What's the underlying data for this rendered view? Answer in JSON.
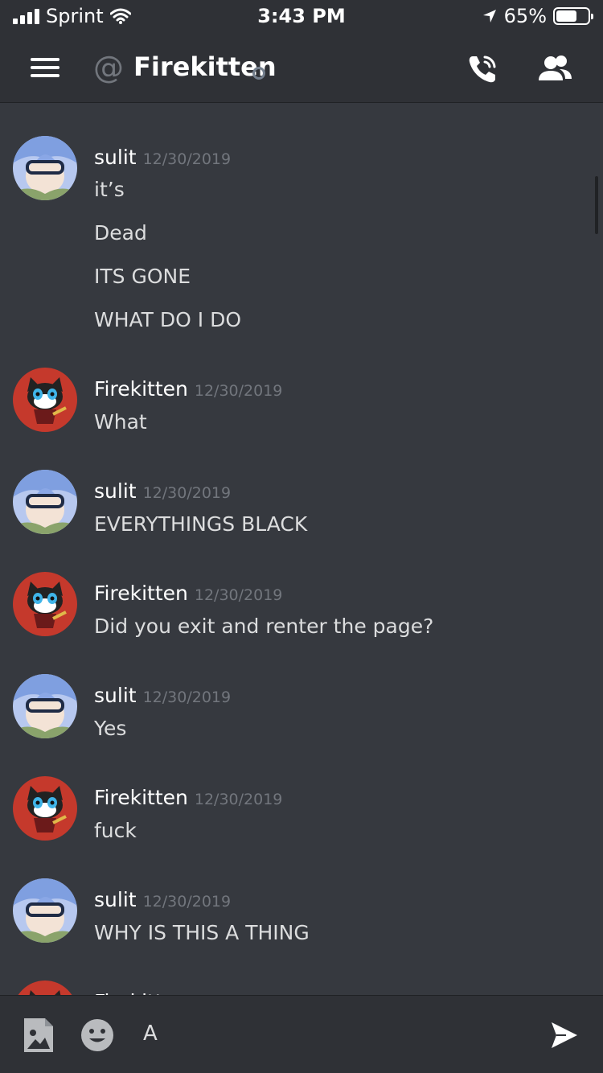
{
  "status_bar": {
    "carrier": "Sprint",
    "time": "3:43 PM",
    "battery": "65%",
    "battery_level": 0.65
  },
  "header": {
    "prefix": "@",
    "title": "Firekitten"
  },
  "messages": [
    {
      "author": "sulit",
      "timestamp": "12/30/2019",
      "avatar": "sulit-avatar",
      "lines": [
        "it’s",
        "Dead",
        "ITS GONE",
        "WHAT DO I DO"
      ]
    },
    {
      "author": "Firekitten",
      "timestamp": "12/30/2019",
      "avatar": "firekitten-avatar",
      "lines": [
        "What"
      ]
    },
    {
      "author": "sulit",
      "timestamp": "12/30/2019",
      "avatar": "sulit-avatar",
      "lines": [
        "EVERYTHINGS BLACK"
      ]
    },
    {
      "author": "Firekitten",
      "timestamp": "12/30/2019",
      "avatar": "firekitten-avatar",
      "lines": [
        "Did you exit and renter the page?"
      ]
    },
    {
      "author": "sulit",
      "timestamp": "12/30/2019",
      "avatar": "sulit-avatar",
      "lines": [
        "Yes"
      ]
    },
    {
      "author": "Firekitten",
      "timestamp": "12/30/2019",
      "avatar": "firekitten-avatar",
      "lines": [
        "fuck"
      ]
    },
    {
      "author": "sulit",
      "timestamp": "12/30/2019",
      "avatar": "sulit-avatar",
      "lines": [
        "WHY IS THIS A THING"
      ]
    },
    {
      "author": "Firekitten",
      "timestamp": "",
      "avatar": "firekitten-avatar",
      "lines": []
    }
  ],
  "composer": {
    "input_value": "A"
  },
  "icons": {
    "menu": "hamburger-menu-icon",
    "at": "at-sign-icon",
    "call": "phone-call-icon",
    "members": "members-icon",
    "image": "image-upload-icon",
    "emoji": "emoji-icon",
    "send": "send-icon"
  },
  "colors": {
    "background": "#36393f",
    "header": "#2f3136",
    "text": "#dcddde",
    "muted": "#72767d",
    "firekitten_avatar": "#c5392c",
    "sulit_avatar": "#7f9fe0"
  }
}
